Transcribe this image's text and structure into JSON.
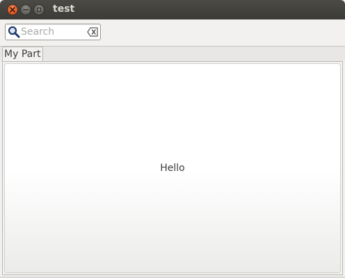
{
  "window": {
    "title": "test"
  },
  "toolbar": {
    "search": {
      "placeholder": "Search",
      "value": ""
    }
  },
  "tabs": [
    {
      "label": "My Part",
      "selected": true
    }
  ],
  "content": {
    "text": "Hello"
  },
  "colors": {
    "titlebar": "#3c3b37",
    "close_button": "#e2541e",
    "window_bg": "#f2f1f0"
  },
  "icons": {
    "search": "search-icon",
    "clear": "clear-icon",
    "close": "close-icon",
    "minimize": "minimize-icon",
    "maximize": "maximize-icon"
  }
}
